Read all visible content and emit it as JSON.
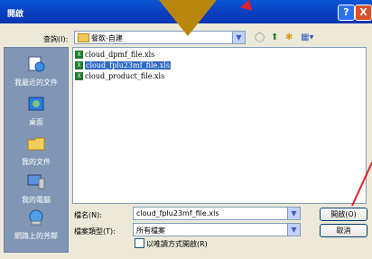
{
  "window": {
    "title": "開啟"
  },
  "titlebar": {
    "help_label": "?",
    "close_label": "X"
  },
  "lookin": {
    "label": "查詢(I):",
    "value": "餐飲-自建"
  },
  "places": [
    {
      "label": "我最近的文件",
      "icon": "recent-documents-icon"
    },
    {
      "label": "桌面",
      "icon": "desktop-icon"
    },
    {
      "label": "我的文件",
      "icon": "my-documents-icon"
    },
    {
      "label": "我的電腦",
      "icon": "my-computer-icon"
    },
    {
      "label": "網路上的芳鄰",
      "icon": "network-places-icon"
    }
  ],
  "files": [
    {
      "name": "cloud_dpmf_file.xls",
      "selected": false
    },
    {
      "name": "cloud_fplu23mf_file.xls",
      "selected": true
    },
    {
      "name": "cloud_product_file.xls",
      "selected": false
    }
  ],
  "filename": {
    "label": "檔名(N):",
    "value": "cloud_fplu23mf_file.xls"
  },
  "filetype": {
    "label": "檔案類型(T):",
    "value": "所有檔案"
  },
  "buttons": {
    "open": "開啟(O)",
    "cancel": "取消"
  },
  "readonly": {
    "label": "以唯讀方式開啟(R)"
  },
  "colors": {
    "title_bar": "#0a3fbf",
    "selection": "#316ac5",
    "overlay_triangle": "#b8860b",
    "annotation": "#e0202a"
  }
}
